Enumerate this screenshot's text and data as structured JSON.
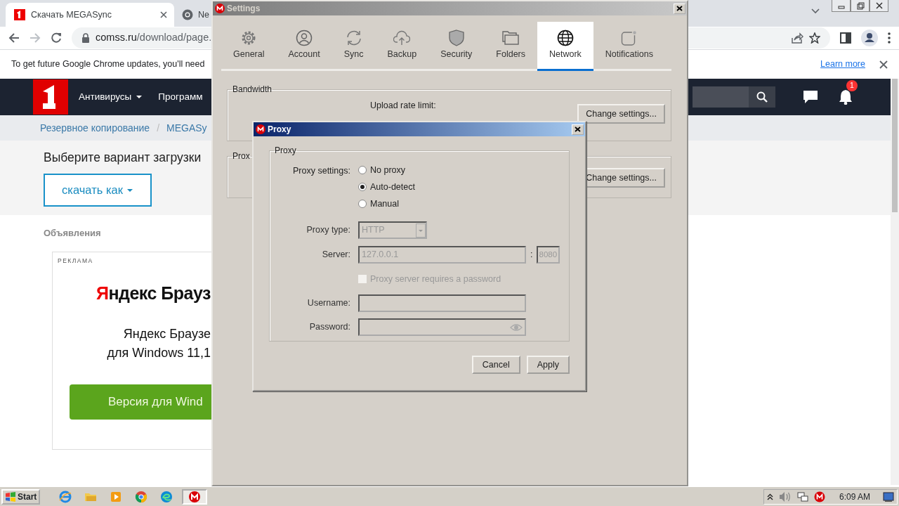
{
  "browser": {
    "tabs": [
      {
        "title": "Скачать MEGASync",
        "selected": true
      },
      {
        "title": "Ne",
        "selected": false
      }
    ],
    "address": "comss.ru/download/page.",
    "infobar": {
      "message": "To get future Google Chrome updates, you'll need",
      "link": "Learn more"
    }
  },
  "site": {
    "nav": [
      {
        "label": "Антивирусы",
        "dropdown": true
      },
      {
        "label": "Программ",
        "dropdown": false
      }
    ],
    "notification_count": "1",
    "breadcrumbs": [
      "Резервное копирование",
      "MEGASy"
    ],
    "breadcrumb_separator": "/",
    "heading": "Выберите вариант загрузки",
    "download_button": "скачать как",
    "ads_title": "Объявления",
    "ad": {
      "tag": "РЕКЛАМА",
      "brand": "Яндекс Брауз",
      "text": "Яндекс Браузе\nдля Windows 11,1",
      "button": "Версия для Wind"
    }
  },
  "settings": {
    "title": "Settings",
    "tabs": [
      {
        "label": "General",
        "selected": false
      },
      {
        "label": "Account",
        "selected": false
      },
      {
        "label": "Sync",
        "selected": false
      },
      {
        "label": "Backup",
        "selected": false
      },
      {
        "label": "Security",
        "selected": false
      },
      {
        "label": "Folders",
        "selected": false
      },
      {
        "label": "Network",
        "selected": true
      },
      {
        "label": "Notifications",
        "selected": false
      }
    ],
    "bandwidth": {
      "title": "Bandwidth",
      "label": "Upload rate limit:",
      "button": "Change settings..."
    },
    "proxy_group": {
      "title": "Prox",
      "button": "Change settings..."
    }
  },
  "proxy_dialog": {
    "title": "Proxy",
    "group": "Proxy",
    "settings_label": "Proxy settings:",
    "options": [
      {
        "label": "No proxy",
        "selected": false
      },
      {
        "label": "Auto-detect",
        "selected": true
      },
      {
        "label": "Manual",
        "selected": false
      }
    ],
    "manual_disabled": true,
    "type_label": "Proxy type:",
    "type_value": "HTTP",
    "server_label": "Server:",
    "server": "127.0.0.1",
    "port_separator": ":",
    "port": "8080",
    "auth": {
      "label": "Proxy server requires a password",
      "checked": false
    },
    "username_label": "Username:",
    "password_label": "Password:",
    "buttons": [
      "Cancel",
      "Apply"
    ]
  },
  "taskbar": {
    "start": "Start",
    "clock": "6:09 AM",
    "apps": [
      {
        "pressed": false
      },
      {
        "pressed": false
      },
      {
        "pressed": false
      },
      {
        "pressed": false
      },
      {
        "pressed": false
      },
      {
        "pressed": true
      }
    ]
  }
}
